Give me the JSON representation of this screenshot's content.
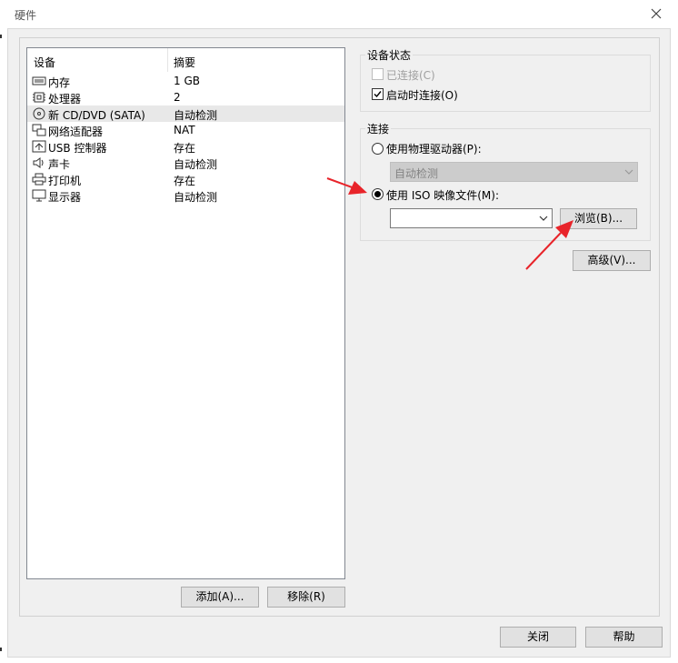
{
  "window": {
    "title": "硬件"
  },
  "device_list": {
    "headers": {
      "device": "设备",
      "summary": "摘要"
    },
    "rows": [
      {
        "icon": "memory-icon",
        "name": "内存",
        "summary": "1 GB",
        "selected": false
      },
      {
        "icon": "processor-icon",
        "name": "处理器",
        "summary": "2",
        "selected": false
      },
      {
        "icon": "cd-dvd-icon",
        "name": "新 CD/DVD (SATA)",
        "summary": "自动检测",
        "selected": true
      },
      {
        "icon": "network-adapter-icon",
        "name": "网络适配器",
        "summary": "NAT",
        "selected": false
      },
      {
        "icon": "usb-controller-icon",
        "name": "USB 控制器",
        "summary": "存在",
        "selected": false
      },
      {
        "icon": "sound-card-icon",
        "name": "声卡",
        "summary": "自动检测",
        "selected": false
      },
      {
        "icon": "printer-icon",
        "name": "打印机",
        "summary": "存在",
        "selected": false
      },
      {
        "icon": "display-icon",
        "name": "显示器",
        "summary": "自动检测",
        "selected": false
      }
    ]
  },
  "buttons": {
    "add": "添加(A)...",
    "remove": "移除(R)",
    "browse": "浏览(B)...",
    "advanced": "高级(V)...",
    "close": "关闭",
    "help": "帮助"
  },
  "device_status": {
    "title": "设备状态",
    "connected": {
      "label": "已连接(C)",
      "checked": false,
      "disabled": true
    },
    "connect_at_power_on": {
      "label": "启动时连接(O)",
      "checked": true,
      "disabled": false
    }
  },
  "connection": {
    "title": "连接",
    "physical_drive": {
      "label": "使用物理驱动器(P):",
      "selected": false,
      "dropdown_value": "自动检测"
    },
    "iso_image": {
      "label": "使用 ISO 映像文件(M):",
      "selected": true,
      "path_value": ""
    }
  },
  "colors": {
    "arrow": "#e8242a",
    "selection": "#e8e8e8",
    "panel": "#f0f0f0"
  }
}
